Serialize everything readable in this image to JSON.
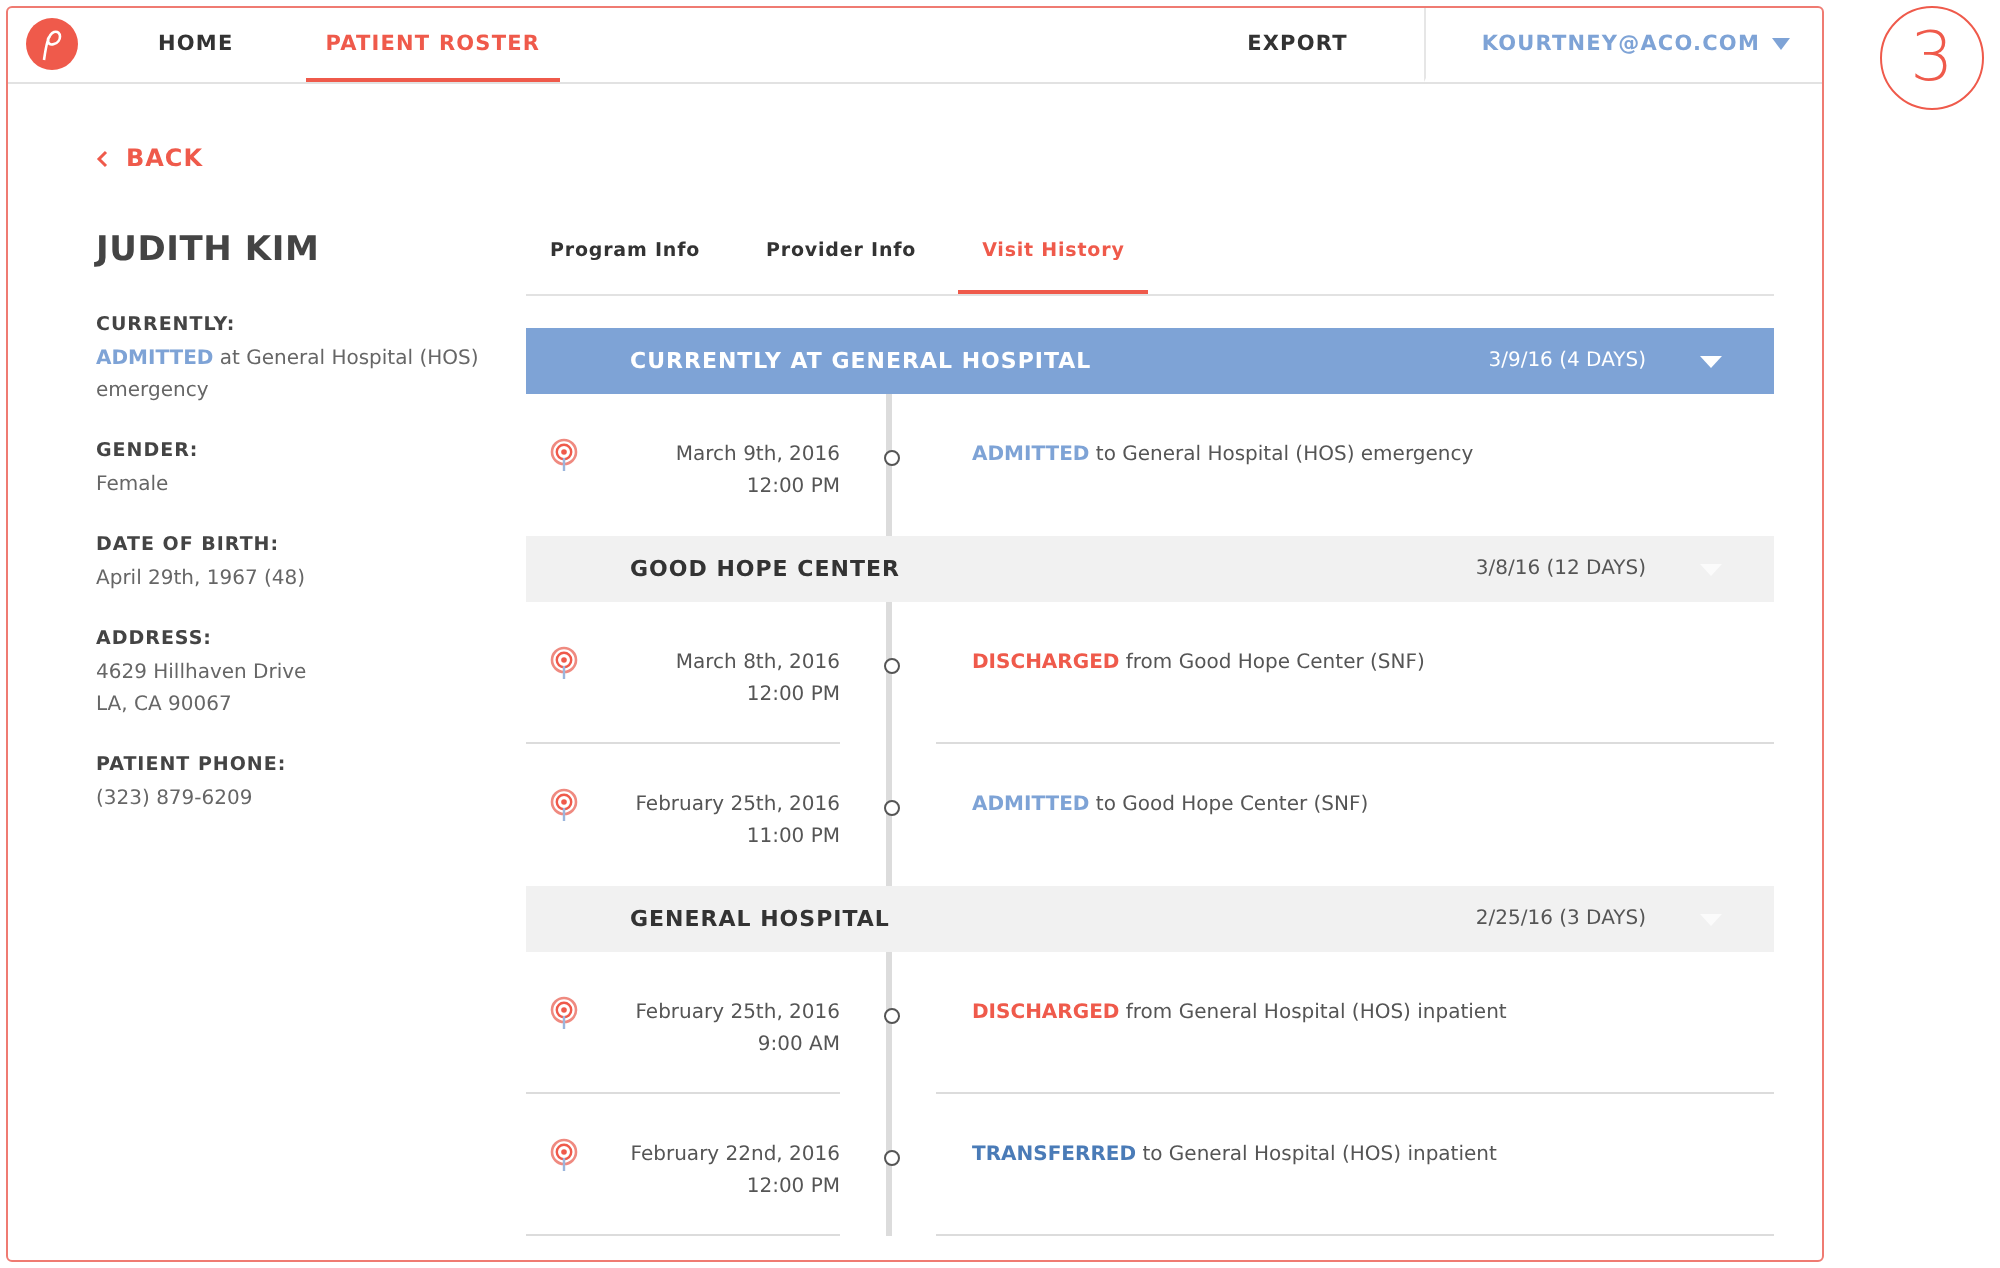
{
  "nav": {
    "items": [
      {
        "label": "HOME",
        "selected": false
      },
      {
        "label": "PATIENT ROSTER",
        "selected": true
      }
    ],
    "export": "EXPORT",
    "user": "KOURTNEY@ACO.COM"
  },
  "step_badge": "3",
  "back": "BACK",
  "patient": {
    "name": "JUDITH KIM",
    "fields": [
      {
        "label": "CURRENTLY:",
        "value": "**ADMITTED** at General Hospital (HOS) emergency",
        "kind": "admitted"
      },
      {
        "label": "GENDER:",
        "value": "Female"
      },
      {
        "label": "DATE OF BIRTH:",
        "value": "April 29th, 1967 (48)"
      },
      {
        "label": "ADDRESS:",
        "value": "4629 Hillhaven Drive\nLA, CA 90067"
      },
      {
        "label": "PATIENT PHONE:",
        "value": "(323) 879-6209"
      }
    ]
  },
  "tabs": [
    {
      "label": "Program Info",
      "selected": false
    },
    {
      "label": "Provider Info",
      "selected": false
    },
    {
      "label": "Visit History",
      "selected": true
    }
  ],
  "visits": [
    {
      "title": "CURRENTLY AT GENERAL HOSPITAL",
      "dates": "3/9/16 (4 DAYS)",
      "current": true,
      "events": [
        {
          "date": "March 9th, 2016",
          "time": "12:00 PM",
          "kind": "admitted",
          "text": "**ADMITTED** to General Hospital (HOS) emergency"
        }
      ]
    },
    {
      "title": "GOOD HOPE CENTER",
      "dates": "3/8/16 (12 DAYS)",
      "current": false,
      "events": [
        {
          "date": "March 8th, 2016",
          "time": "12:00 PM",
          "kind": "discharged",
          "text": "**DISCHARGED** from Good Hope Center (SNF)"
        },
        {
          "date": "February 25th, 2016",
          "time": "11:00 PM",
          "kind": "admitted",
          "text": "**ADMITTED** to Good Hope Center (SNF)"
        }
      ]
    },
    {
      "title": "GENERAL HOSPITAL",
      "dates": "2/25/16 (3 DAYS)",
      "current": false,
      "events": [
        {
          "date": "February 25th, 2016",
          "time": "9:00 AM",
          "kind": "discharged",
          "text": "**DISCHARGED** from General Hospital (HOS) inpatient"
        },
        {
          "date": "February 22nd, 2016",
          "time": "12:00 PM",
          "kind": "transferred",
          "text": "**TRANSFERRED** to General Hospital (HOS) inpatient"
        }
      ]
    }
  ]
}
